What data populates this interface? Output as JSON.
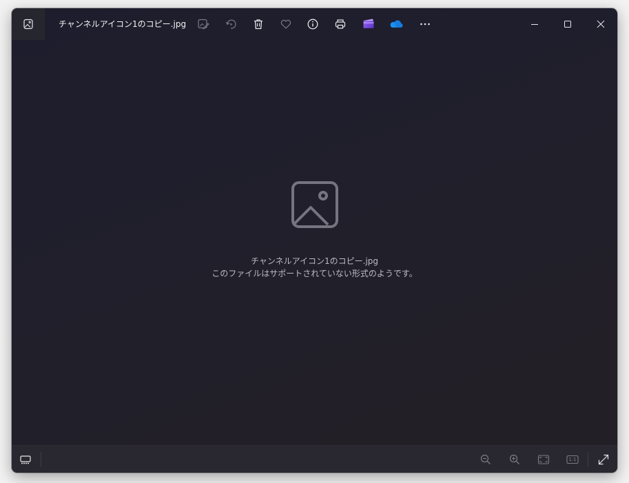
{
  "window": {
    "title": "チャンネルアイコン1のコピー.jpg"
  },
  "toolbar": {
    "items": [
      {
        "icon": "edit-image-icon",
        "label": "Edit image"
      },
      {
        "icon": "rotate-icon",
        "label": "Rotate"
      },
      {
        "icon": "delete-icon",
        "label": "Delete"
      },
      {
        "icon": "favorite-icon",
        "label": "Favorite"
      },
      {
        "icon": "info-icon",
        "label": "File information"
      },
      {
        "icon": "print-icon",
        "label": "Print"
      },
      {
        "icon": "clipchamp-icon",
        "label": "Clipchamp"
      },
      {
        "icon": "onedrive-icon",
        "label": "OneDrive"
      },
      {
        "icon": "more-icon",
        "label": "See more"
      }
    ]
  },
  "content": {
    "file_name": "チャンネルアイコン1のコピー.jpg",
    "message": "このファイルはサポートされていない形式のようです。"
  },
  "bottombar": {
    "zoom_out": "zoom-out-icon",
    "zoom_in": "zoom-in-icon",
    "fit": "fit-to-window-icon",
    "actual_size_label": "1:1",
    "fullscreen": "fullscreen-icon"
  },
  "colors": {
    "background_start": "#1d1d2d",
    "background_end": "#231f25",
    "bottombar": "#29272f",
    "icon_active": "#e8e8ec",
    "icon_disabled": "#7d7b85",
    "onedrive_blue": "#1b8ff0",
    "clipchamp_purple": "#7b4ce0"
  }
}
